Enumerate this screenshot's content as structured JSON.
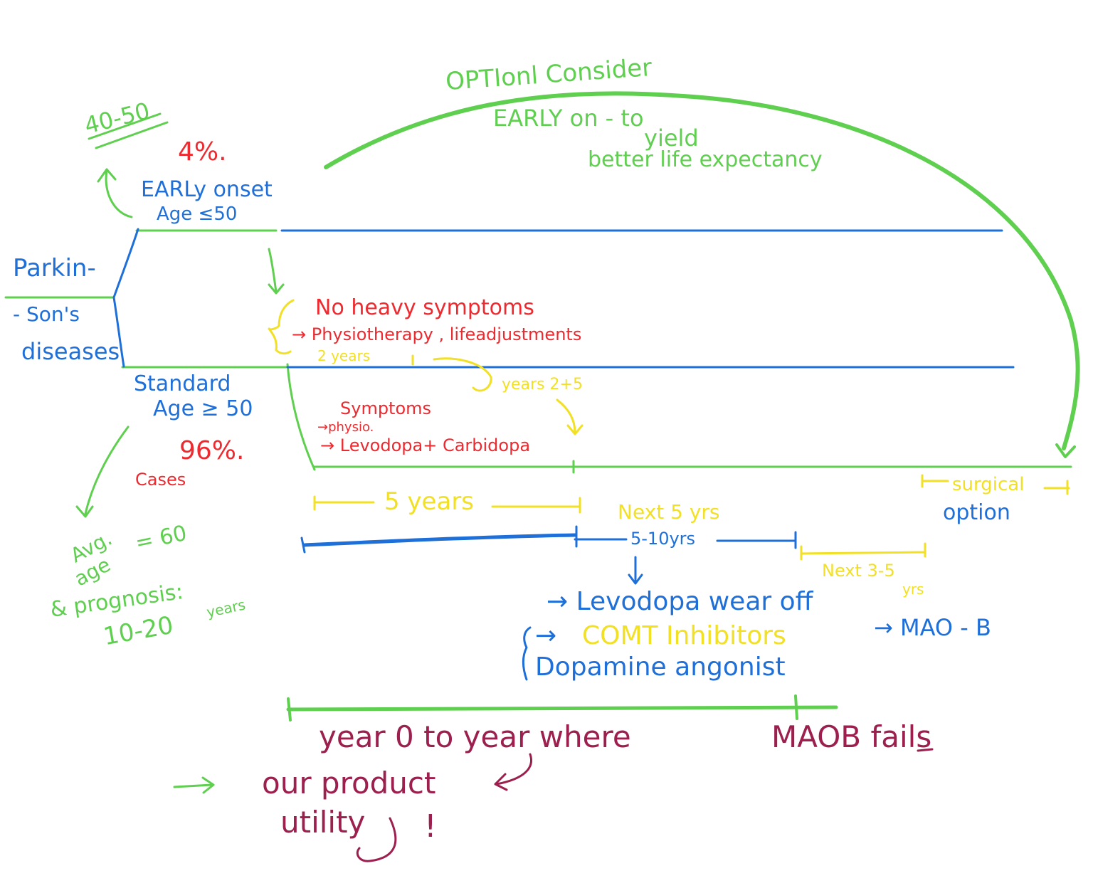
{
  "colors": {
    "green": "#5fcf4f",
    "blue": "#1f6fd9",
    "red": "#ec2a2f",
    "yellow": "#f2e024",
    "maroon": "#9c1f4e"
  },
  "labels": {
    "optional_consider": "OPTIonl Consider",
    "early_on": "EARLY on - to",
    "yield": "yield",
    "better_life": "better life expectancy",
    "age_40_50": "40-50",
    "pct_4": "4%.",
    "early_onset": "EARLy onset",
    "age_le_50": "Age ≤50",
    "parkin": "Parkin-",
    "sons": "- Son's",
    "diseases": "diseases",
    "no_heavy": "No heavy symptoms",
    "physio_life": "→ Physiotherapy , lifeadjustments",
    "two_years": "2 years",
    "years_2_5": "years 2+5",
    "standard": "Standard",
    "age_ge_50": "Age ≥ 50",
    "pct_96": "96%.",
    "cases": "Cases",
    "symptoms": "Symptoms",
    "physio": "→physio.",
    "levodopa_carbidopa": "→ Levodopa+ Carbidopa",
    "five_years": "5 years",
    "next_5_yrs": "Next 5 yrs",
    "five_ten_yrs": "5-10yrs",
    "surgical": "surgical",
    "option": "option",
    "next_3_5": "Next 3-5",
    "yrs": "yrs",
    "avg": "Avg.",
    "age": "age",
    "eq_60": "= 60",
    "prognosis": "& prognosis:",
    "ten_twenty": "10-20",
    "years_small": "years",
    "levodopa_wear": "→ Levodopa wear off",
    "comt": "COMT Inhibitors",
    "dopamine": "Dopamine angonist",
    "maob": "→ MAO - B",
    "year_zero": "year 0 to year where",
    "maob_fails": "MAOB fails",
    "our_product": "our product",
    "utility": "utility",
    "exclaim": "!"
  }
}
